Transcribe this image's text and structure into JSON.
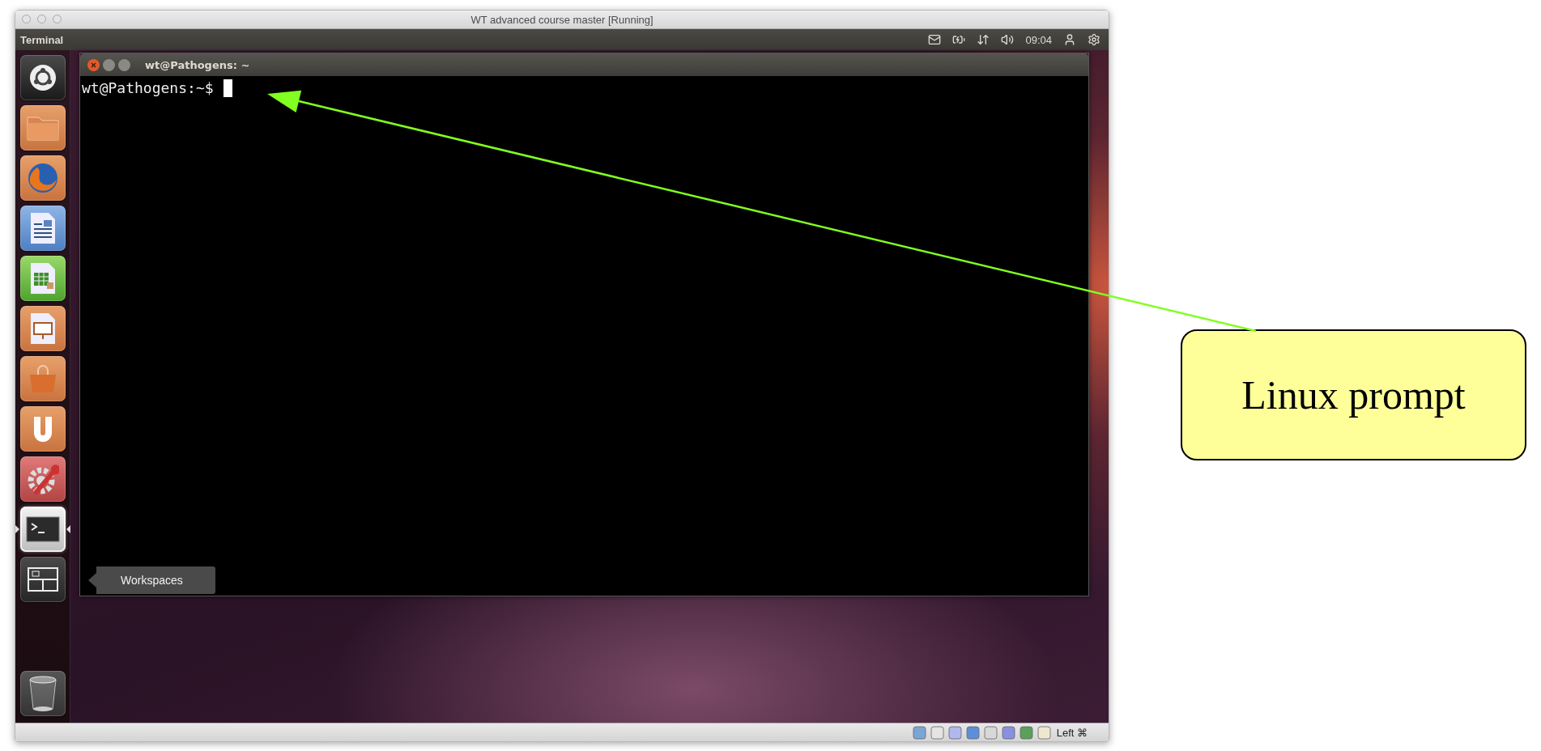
{
  "window": {
    "title": "WT advanced course master [Running]"
  },
  "top_panel": {
    "app_name": "Terminal",
    "clock": "09:04"
  },
  "launcher": {
    "items": [
      {
        "kind": "dash",
        "selected": false
      },
      {
        "kind": "files",
        "selected": false
      },
      {
        "kind": "browser",
        "selected": false
      },
      {
        "kind": "writer",
        "selected": false
      },
      {
        "kind": "calc",
        "selected": false
      },
      {
        "kind": "impress",
        "selected": false
      },
      {
        "kind": "software",
        "selected": false
      },
      {
        "kind": "ubuntuone",
        "selected": false
      },
      {
        "kind": "settings",
        "selected": false
      },
      {
        "kind": "terminal",
        "selected": true
      },
      {
        "kind": "workspaces",
        "selected": false
      }
    ],
    "tooltip": "Workspaces",
    "trash": {
      "kind": "trash"
    }
  },
  "terminal": {
    "title": "wt@Pathogens: ~",
    "prompt": "wt@Pathogens:~$"
  },
  "status_bar": {
    "host_key": "Left ⌘"
  },
  "callout": {
    "text": "Linux prompt"
  }
}
